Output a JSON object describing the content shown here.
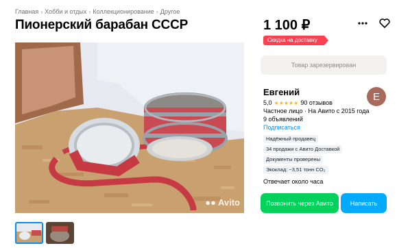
{
  "breadcrumb": [
    "Главная",
    "Хобби и отдых",
    "Коллекционирование",
    "Другое"
  ],
  "title": "Пионерский барабан СССР",
  "price": "1 100 ₽",
  "delivery_badge": "Скидка на доставку",
  "reserved_button": "Товар зарезервирован",
  "seller": {
    "name": "Евгений",
    "avatar_letter": "Е",
    "rating": "5,0",
    "stars": "★★★★★",
    "reviews": "90 отзывов",
    "info": "Частное лицо · На Авито с 2015 года",
    "ads_count": "9 объявлений",
    "subscribe": "Подписаться"
  },
  "badges": [
    "Надёжный продавец",
    "34 продажи с Авито Доставкой",
    "Документы проверены",
    "Экоклад: ~3,51 тонн CO₂"
  ],
  "response_time": "Отвечает около часа",
  "buttons": {
    "call": "Позвонить через Авито",
    "write": "Написать"
  },
  "watermark": "Avito",
  "icons": {
    "more": "more-dots-icon",
    "favorite": "heart-icon"
  },
  "colors": {
    "accent_green": "#02d15c",
    "accent_blue": "#00aaff",
    "badge_red": "#ff4053",
    "link_blue": "#0a8cf0"
  }
}
